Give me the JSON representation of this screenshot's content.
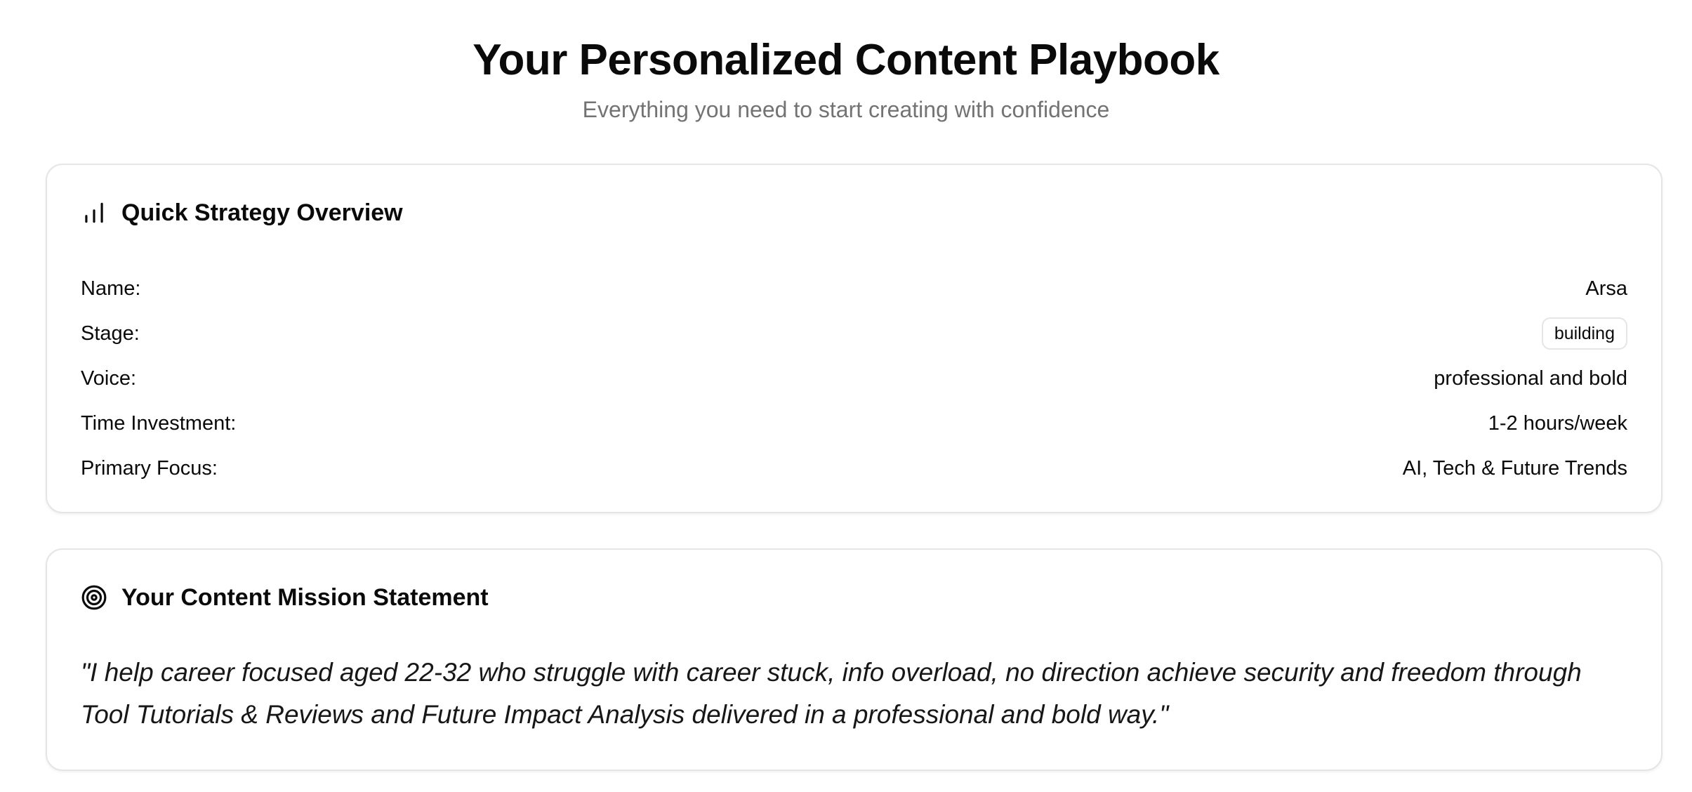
{
  "header": {
    "title": "Your Personalized Content Playbook",
    "subtitle": "Everything you need to start creating with confidence"
  },
  "overview": {
    "icon": "bar-chart-icon",
    "title": "Quick Strategy Overview",
    "rows": [
      {
        "label": "Name:",
        "value": "Arsa"
      },
      {
        "label": "Stage:",
        "value": "building"
      },
      {
        "label": "Voice:",
        "value": "professional and bold"
      },
      {
        "label": "Time Investment:",
        "value": "1-2 hours/week"
      },
      {
        "label": "Primary Focus:",
        "value": "AI, Tech & Future Trends"
      }
    ]
  },
  "mission": {
    "icon": "target-icon",
    "title": "Your Content Mission Statement",
    "text": "\"I help career focused aged 22-32 who struggle with career stuck, info overload, no direction achieve security and freedom through Tool Tutorials & Reviews and Future Impact Analysis delivered in a professional and bold way.\""
  },
  "colors": {
    "text": "#0a0a0a",
    "muted": "#737373",
    "border": "#e5e5e5",
    "background": "#ffffff"
  }
}
